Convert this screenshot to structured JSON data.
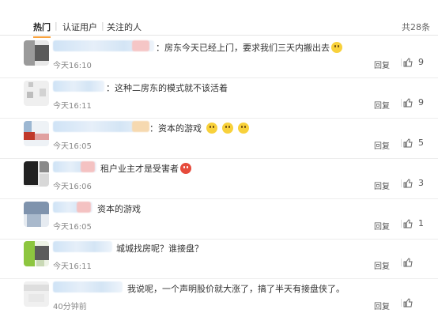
{
  "tabs": [
    {
      "label": "热门",
      "active": true
    },
    {
      "label": "认证用户"
    },
    {
      "label": "关注的人"
    }
  ],
  "total_count": "共28条",
  "reply_label": "回复",
  "comments": [
    {
      "text": "：房东今天已经上门，要求我们三天内搬出去",
      "time": "今天16:10",
      "likes": "9",
      "emoji": [
        "cry-emoji"
      ]
    },
    {
      "text": "：这种二房东的模式就不该活着",
      "time": "今天16:11",
      "likes": "9",
      "emoji": []
    },
    {
      "text": "：资本的游戏",
      "time": "今天16:05",
      "likes": "5",
      "emoji": [
        "yawn-emoji",
        "yawn-emoji",
        "yawn-emoji"
      ]
    },
    {
      "text": "租户业主才是受害者",
      "time": "今天16:06",
      "likes": "3",
      "emoji": [
        "angry-emoji"
      ]
    },
    {
      "text": "资本的游戏",
      "time": "今天16:05",
      "likes": "1",
      "emoji": []
    },
    {
      "text": "城城找房呢？谁接盘？",
      "time": "今天16:11",
      "likes": "",
      "emoji": []
    },
    {
      "text": "我说呢，一个声明股价就大涨了，搞了半天有接盘侠了。",
      "time": "40分钟前",
      "likes": "",
      "emoji": []
    }
  ],
  "colors": {
    "accent": "#f9a23d",
    "link": "#eb7350"
  }
}
